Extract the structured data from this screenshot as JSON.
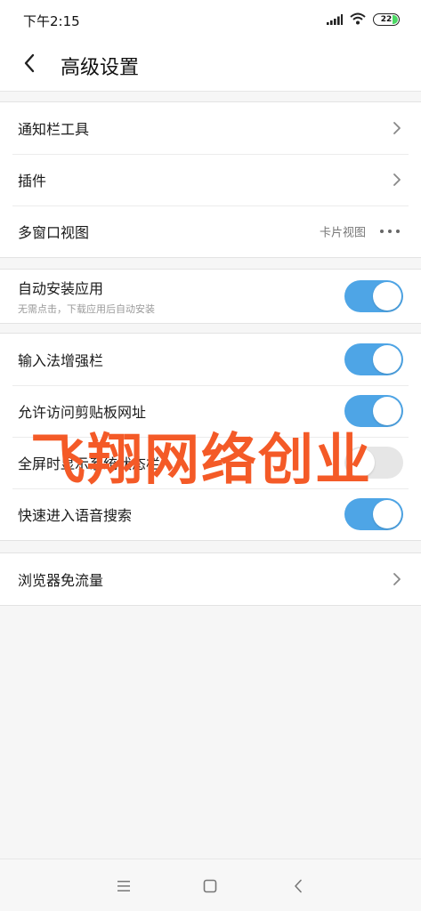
{
  "status_bar": {
    "time": "下午2:15",
    "battery": "22",
    "icons": [
      "signal-icon",
      "wifi-icon",
      "battery-icon"
    ]
  },
  "header": {
    "title": "高级设置",
    "back_icon": "back-chevron-icon"
  },
  "group1": [
    {
      "label": "通知栏工具",
      "icon": "chevron-right-icon"
    },
    {
      "label": "插件",
      "icon": "chevron-right-icon"
    },
    {
      "label": "多窗口视图",
      "value": "卡片视图",
      "icon": "more-dots-icon"
    }
  ],
  "group2": {
    "label": "自动安装应用",
    "sublabel": "无需点击，下载应用后自动安装",
    "toggle_on": true
  },
  "group3": [
    {
      "label": "输入法增强栏",
      "toggle_on": true
    },
    {
      "label": "允许访问剪贴板网址",
      "toggle_on": true
    },
    {
      "label": "全屏时显示系统状态栏",
      "toggle_on": false
    },
    {
      "label": "快速进入语音搜索",
      "toggle_on": true
    }
  ],
  "group4": [
    {
      "label": "浏览器免流量",
      "icon": "chevron-right-icon"
    }
  ],
  "watermark": "飞翔网络创业",
  "colors": {
    "toggle_on": "#4ea5e6",
    "toggle_off": "#e6e6e6",
    "watermark": "#f45a27",
    "battery": "#4bd964"
  },
  "nav_bar": {
    "icons": [
      "menu-icon",
      "home-icon",
      "back-icon"
    ]
  }
}
